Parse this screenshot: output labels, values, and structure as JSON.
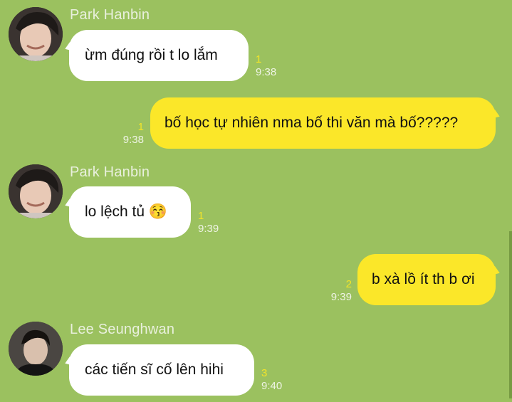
{
  "messages": [
    {
      "sender": "Park Hanbin",
      "avatar": "park-hanbin-avatar",
      "direction": "in",
      "text": "ừm đúng rồi t lo lắm",
      "unread": "1",
      "time": "9:38"
    },
    {
      "direction": "out",
      "text": "bố học tự nhiên nma bố thi văn mà bố?????",
      "unread": "1",
      "time": "9:38"
    },
    {
      "sender": "Park Hanbin",
      "avatar": "park-hanbin-avatar",
      "direction": "in",
      "text": "lo lệch tủ 😚",
      "unread": "1",
      "time": "9:39"
    },
    {
      "direction": "out",
      "text": "b xà lồ ít th b ơi",
      "unread": "2",
      "time": "9:39"
    },
    {
      "sender": "Lee Seunghwan",
      "avatar": "lee-seunghwan-avatar",
      "direction": "in",
      "text": "các tiến sĩ cố lên hihi",
      "unread": "3",
      "time": "9:40"
    }
  ],
  "colors": {
    "background": "#9bc15f",
    "incoming_bubble": "#ffffff",
    "outgoing_bubble": "#fbe729",
    "unread_count": "#f2e42a"
  }
}
